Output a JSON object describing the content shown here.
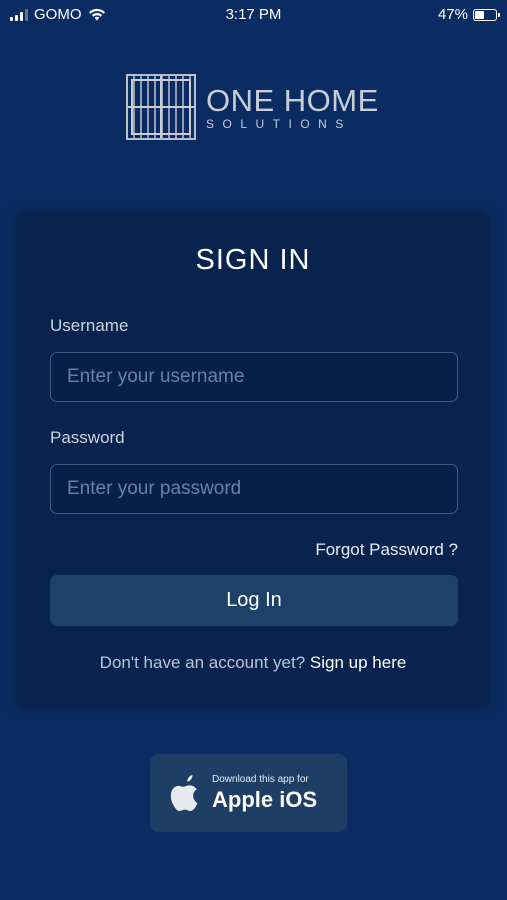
{
  "status_bar": {
    "carrier": "GOMO",
    "time": "3:17 PM",
    "battery": "47%",
    "battery_level": 0.47
  },
  "logo": {
    "title": "ONE HOME",
    "subtitle": "SOLUTIONS"
  },
  "signin": {
    "title": "SIGN IN",
    "username_label": "Username",
    "username_placeholder": "Enter your username",
    "username_value": "",
    "password_label": "Password",
    "password_placeholder": "Enter your password",
    "password_value": "",
    "forgot_password": "Forgot Password ?",
    "login_button": "Log In",
    "no_account_text": "Don't have an account yet?",
    "signup_link": "Sign up here"
  },
  "download_badge": {
    "small_text": "Download this app for",
    "big_text": "Apple iOS"
  },
  "colors": {
    "background": "#0b2c62",
    "card": "#08234d",
    "button": "#1e416a"
  }
}
